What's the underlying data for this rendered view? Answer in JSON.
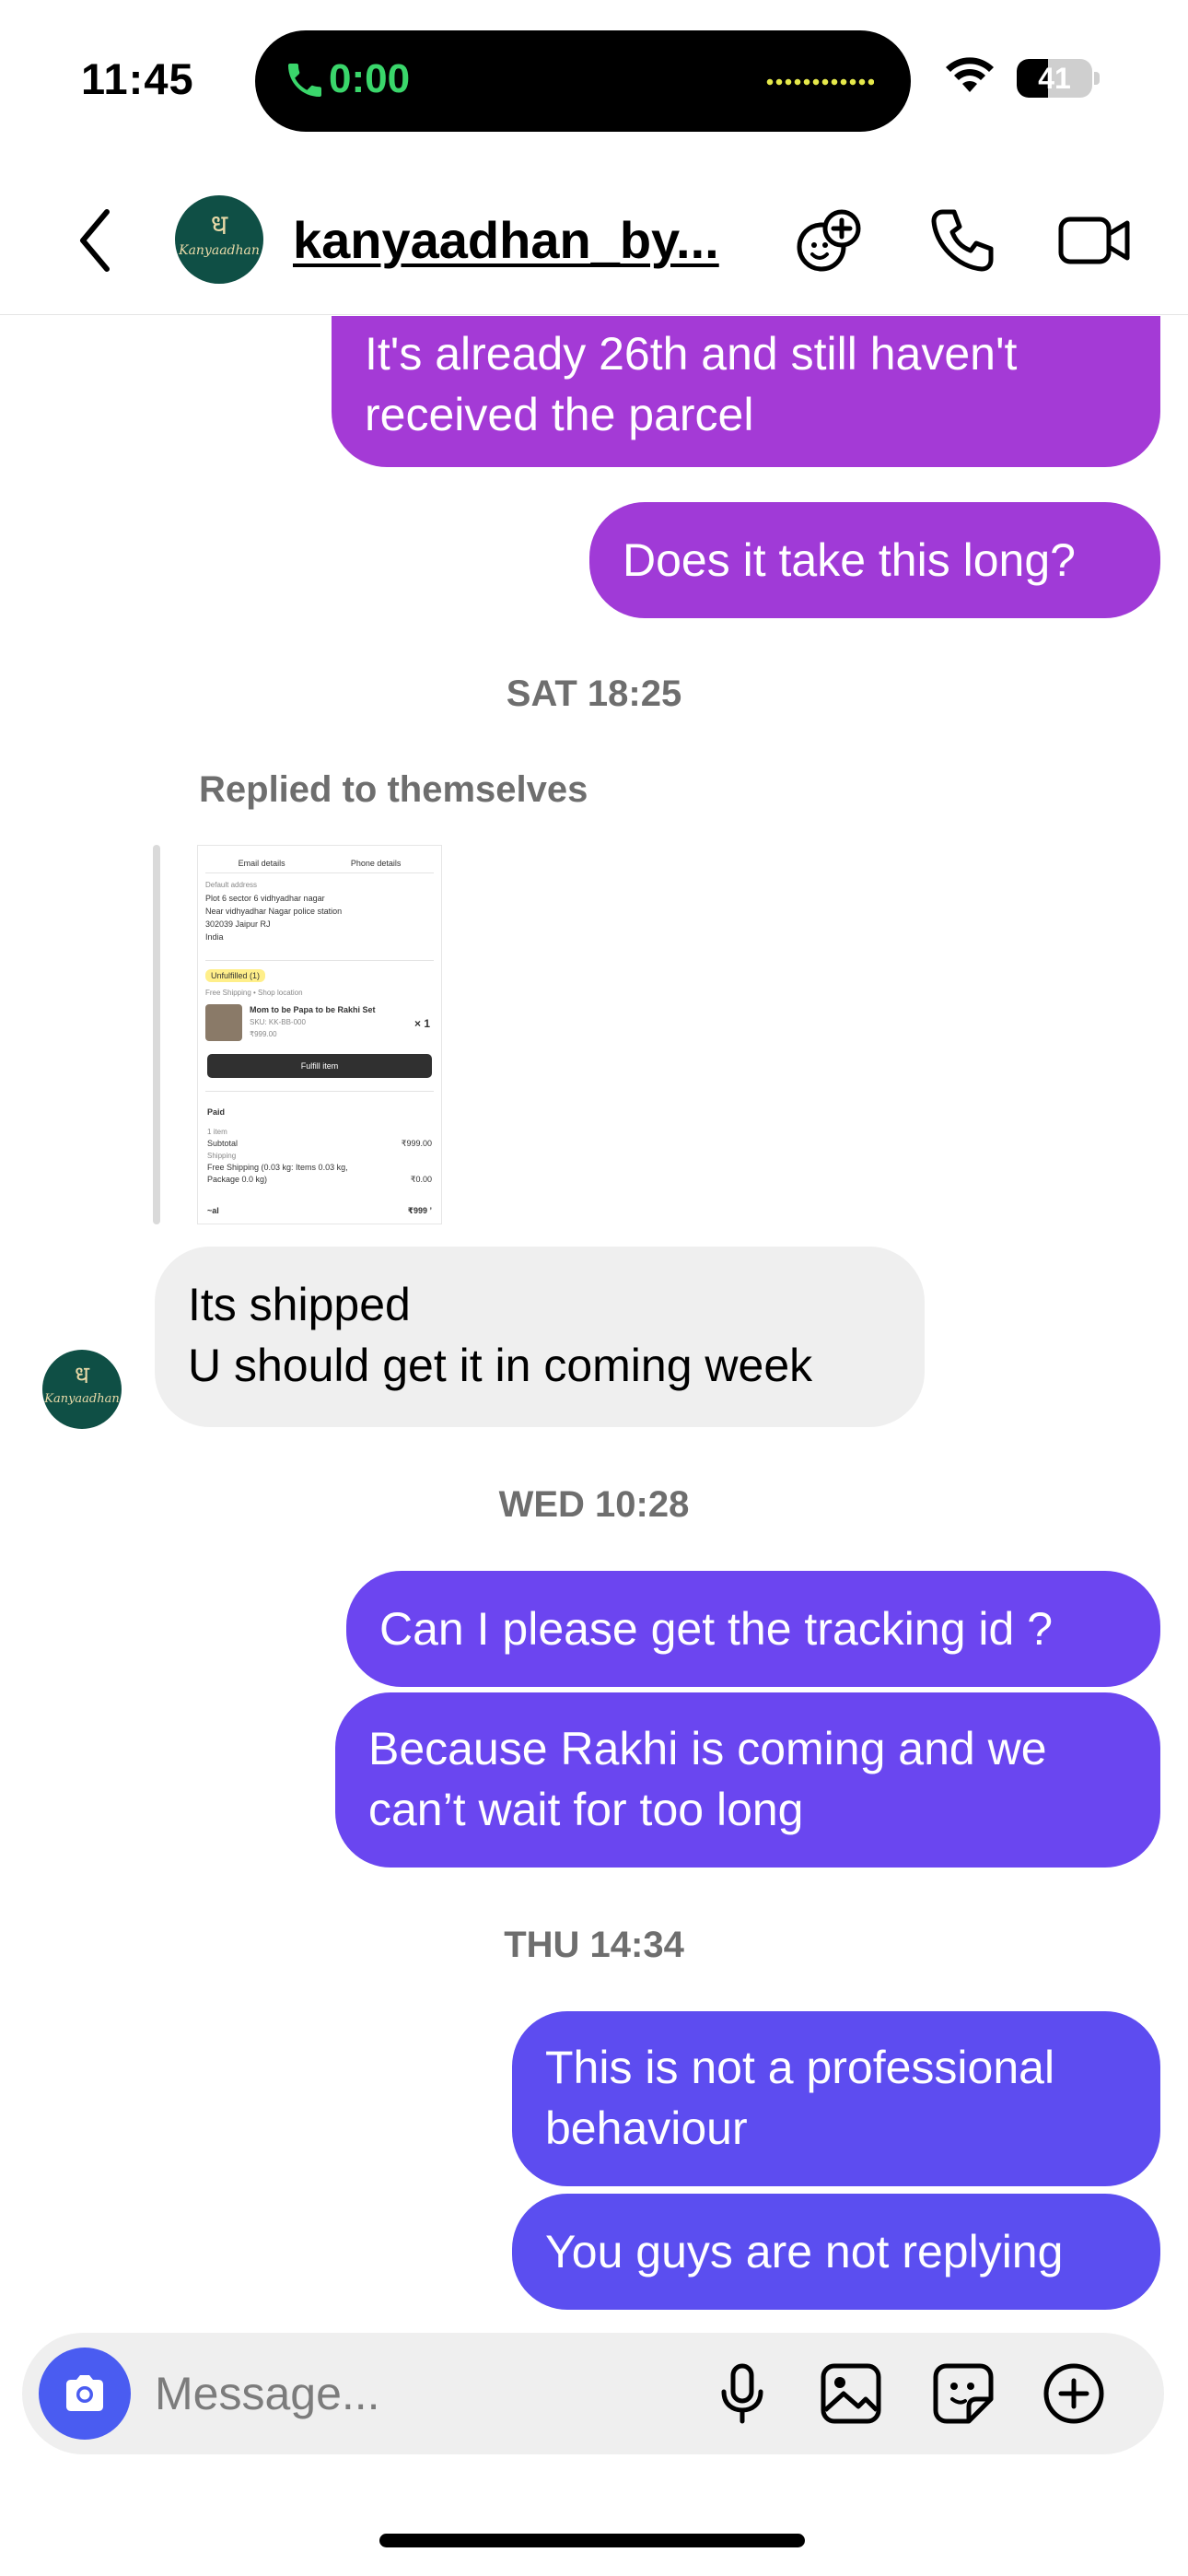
{
  "status_bar": {
    "time": "11:45",
    "call_timer": "0:00",
    "battery_level": "41",
    "battery_fraction": 0.41
  },
  "header": {
    "contact_name": "kanyaadhan_by...",
    "avatar_glyph": "ध",
    "avatar_brand": "Kanyaadhan"
  },
  "messages": [
    {
      "direction": "outgoing",
      "text": "It's already 26th and still haven't received the parcel",
      "color": "#a43ad6"
    },
    {
      "direction": "outgoing",
      "text": "Does it take this long?",
      "color": "#a03ad7"
    },
    {
      "type": "timestamp",
      "text": "SAT 18:25"
    },
    {
      "type": "reply_label",
      "text": "Replied to themselves"
    },
    {
      "direction": "incoming",
      "text_line1": "Its shipped",
      "text_line2": "U should get it in coming week"
    },
    {
      "type": "timestamp",
      "text": "WED 10:28"
    },
    {
      "direction": "outgoing",
      "text": "Can I please get the tracking id ?",
      "color": "#6c45f0"
    },
    {
      "direction": "outgoing",
      "text": "Because Rakhi is coming and we can’t wait for too long",
      "color": "#6a46f0"
    },
    {
      "type": "timestamp",
      "text": "THU 14:34"
    },
    {
      "direction": "outgoing",
      "text": "This is not a professional behaviour",
      "color": "#5d4cf0"
    },
    {
      "direction": "outgoing",
      "text": "You guys are not replying",
      "color": "#5b4ef0"
    }
  ],
  "shared_screenshot": {
    "tab_email": "Email details",
    "tab_phone": "Phone details",
    "address_label": "Default address",
    "address_lines": [
      "Plot 6 sector 6 vidhyadhar nagar",
      "Near vidhyadhar Nagar police station",
      "302039 Jaipur RJ",
      "India"
    ],
    "status_badge": "Unfulfilled (1)",
    "shipping_line": "Free Shipping • Shop location",
    "product_name": "Mom to be Papa to be Rakhi Set",
    "product_sku": "SKU: KK-BB-000",
    "product_price": "₹999.00",
    "product_qty": "× 1",
    "fulfill_button": "Fulfill item",
    "paid_label": "Paid",
    "items_label": "1 item",
    "subtotal_label": "Subtotal",
    "subtotal_value": "₹999.00",
    "shipping_label": "Shipping",
    "shipping_detail": "Free Shipping (0.03 kg: Items 0.03 kg, Package 0.0 kg)",
    "shipping_value": "₹0.00",
    "total_label": "~al",
    "total_value": "₹999 ’"
  },
  "composer": {
    "placeholder": "Message..."
  },
  "colors": {
    "accent": "#4a5cf1",
    "incoming_bubble": "#efefef",
    "avatar_bg": "#0f4f45",
    "call_green": "#3ad66b"
  },
  "icons": [
    "phone-icon",
    "wifi-icon",
    "back-icon",
    "effects-icon",
    "voice-call-icon",
    "video-call-icon",
    "camera-icon",
    "microphone-icon",
    "gallery-icon",
    "sticker-icon",
    "plus-icon"
  ]
}
